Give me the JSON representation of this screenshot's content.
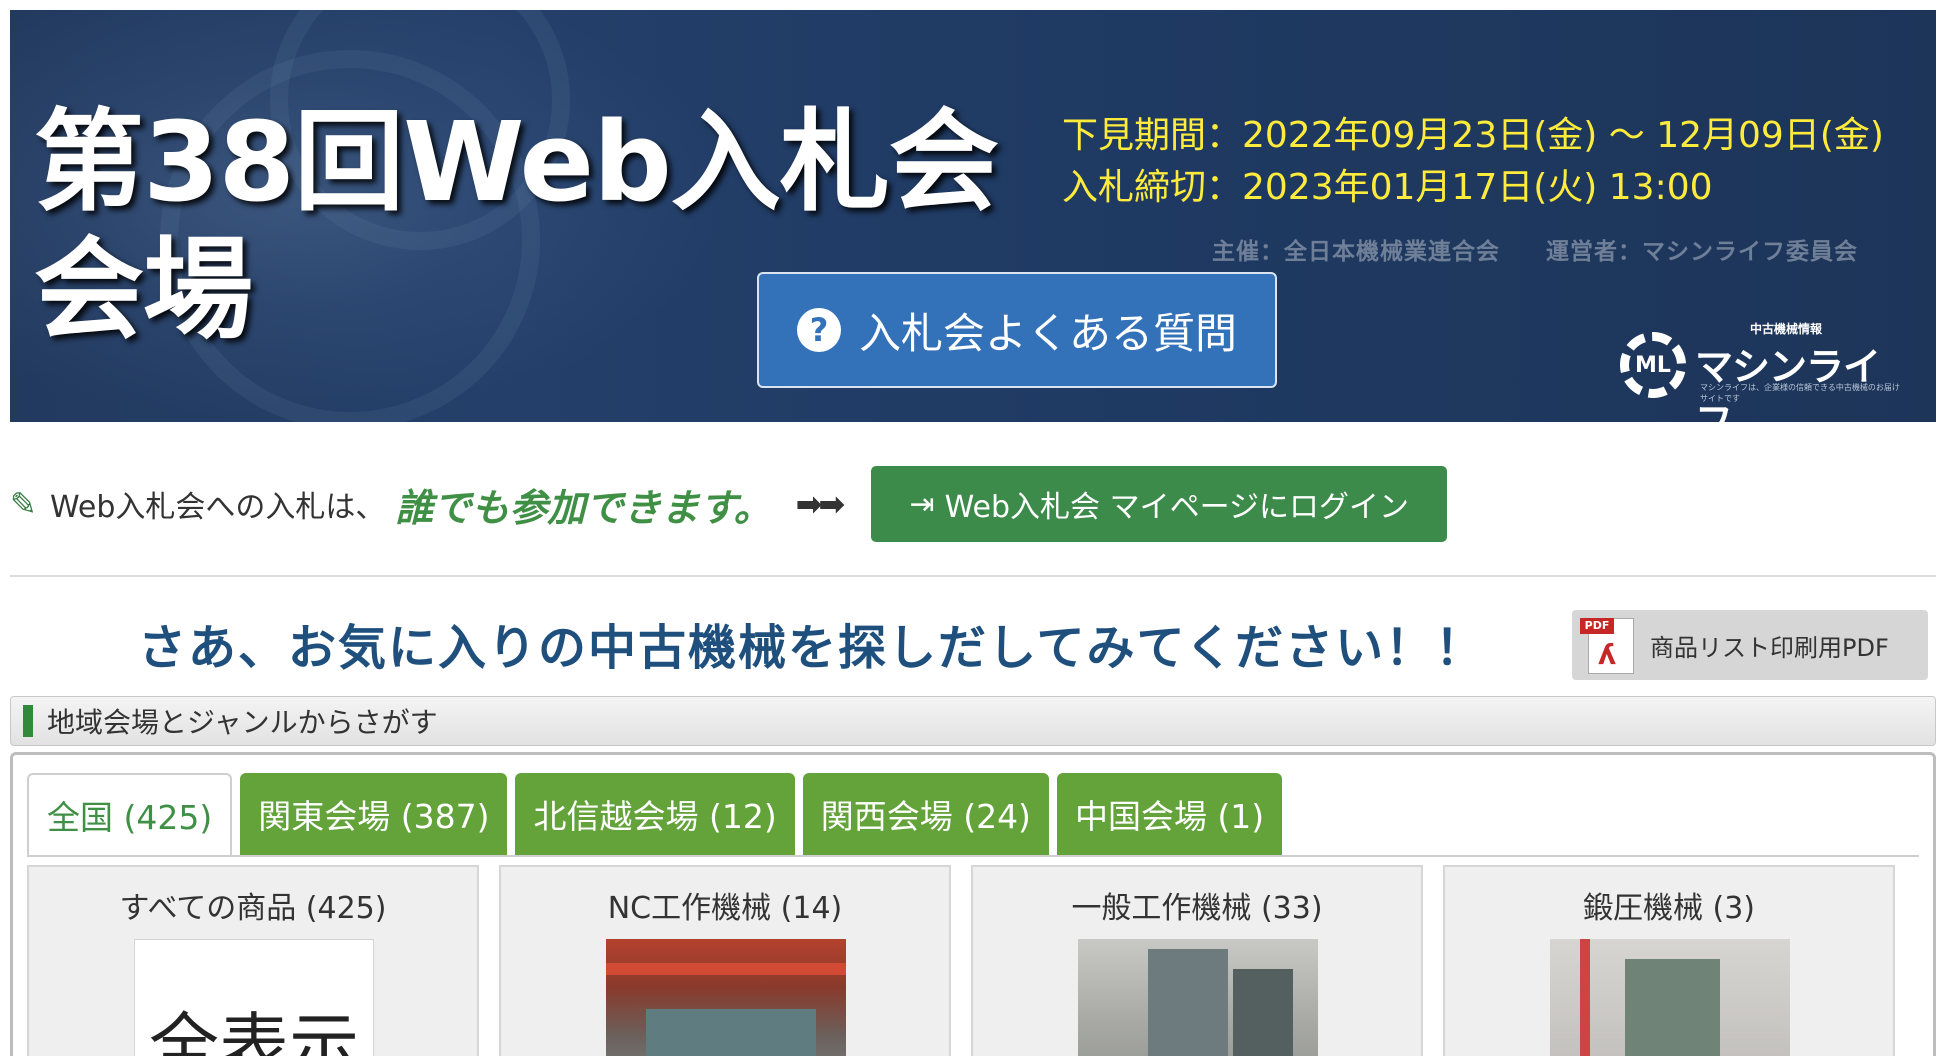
{
  "banner": {
    "title_line1": "第38回Web入札会",
    "title_line2": "会場",
    "preview_period": "下見期間：2022年09月23日(金) 〜 12月09日(金)",
    "bid_deadline": "入札締切：2023年01月17日(火) 13:00",
    "organizer": "主催：全日本機械業連合会",
    "operator": "運営者：マシンライフ委員会",
    "faq_button_label": "入札会よくある質問",
    "faq_icon": "question-circle-icon",
    "logo": {
      "sub": "中古機械情報",
      "main": "マシンライフ",
      "mark": "ML",
      "tagline": "マシンライフは、企業様の信頼できる中古機械のお届けサイトです"
    }
  },
  "participate": {
    "lead_text": "Web入札会への入札は、",
    "emphasis_text": "誰でも参加できます。",
    "arrows": "➡➡",
    "login_button_label": "Web入札会 マイページにログイン",
    "login_icon": "sign-in-icon",
    "edit_icon": "edit-icon"
  },
  "catch_text": "さあ、お気に入りの中古機械を探しだしてみてください！！",
  "pdf_button": {
    "label": "商品リスト印刷用PDF",
    "icon": "pdf-icon",
    "icon_tag": "PDF"
  },
  "section_header": "地域会場とジャンルからさがす",
  "tabs": [
    {
      "label": "全国 (425)",
      "active": true
    },
    {
      "label": "関東会場 (387)",
      "active": false
    },
    {
      "label": "北信越会場 (12)",
      "active": false
    },
    {
      "label": "関西会場 (24)",
      "active": false
    },
    {
      "label": "中国会場 (1)",
      "active": false
    }
  ],
  "categories": [
    {
      "title": "すべての商品 (425)",
      "thumb_text": "全表示"
    },
    {
      "title": "NC工作機械 (14)"
    },
    {
      "title": "一般工作機械 (33)"
    },
    {
      "title": "鍛圧機械 (3)"
    }
  ],
  "colors": {
    "banner_bg": "#233a5f",
    "date_text": "#ffeb3b",
    "faq_button": "#3371b8",
    "login_button": "#3d8b4b",
    "tab_inactive": "#63a33a",
    "catch_text": "#1f4f7c"
  }
}
